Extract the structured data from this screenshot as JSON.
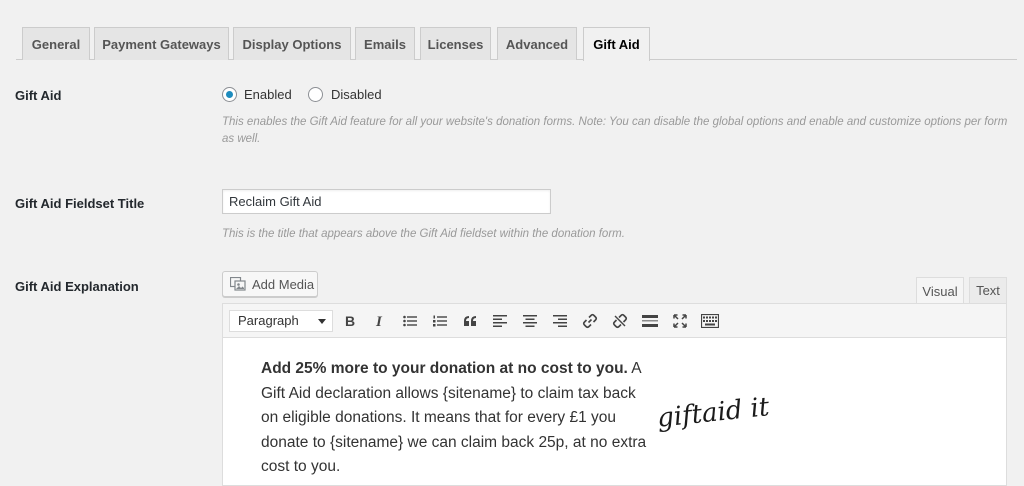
{
  "tabs": [
    {
      "label": "General",
      "active": false
    },
    {
      "label": "Payment Gateways",
      "active": false
    },
    {
      "label": "Display Options",
      "active": false
    },
    {
      "label": "Emails",
      "active": false
    },
    {
      "label": "Licenses",
      "active": false
    },
    {
      "label": "Advanced",
      "active": false
    },
    {
      "label": "Gift Aid",
      "active": true
    }
  ],
  "gift_aid": {
    "label": "Gift Aid",
    "options": [
      {
        "label": "Enabled",
        "checked": true
      },
      {
        "label": "Disabled",
        "checked": false
      }
    ],
    "description": "This enables the Gift Aid feature for all your website's donation forms. Note: You can disable the global options and enable and customize options per form as well."
  },
  "fieldset_title": {
    "label": "Gift Aid Fieldset Title",
    "value": "Reclaim Gift Aid",
    "description": "This is the title that appears above the Gift Aid fieldset within the donation form."
  },
  "explanation": {
    "label": "Gift Aid Explanation",
    "add_media_label": "Add Media",
    "visual_tab": "Visual",
    "text_tab": "Text",
    "format_select": "Paragraph",
    "toolbar": [
      {
        "name": "bold-icon"
      },
      {
        "name": "italic-icon"
      },
      {
        "name": "bullet-list-icon"
      },
      {
        "name": "numbered-list-icon"
      },
      {
        "name": "blockquote-icon"
      },
      {
        "name": "align-left-icon"
      },
      {
        "name": "align-center-icon"
      },
      {
        "name": "align-right-icon"
      },
      {
        "name": "insert-link-icon"
      },
      {
        "name": "remove-link-icon"
      },
      {
        "name": "read-more-icon"
      },
      {
        "name": "fullscreen-icon"
      },
      {
        "name": "toolbar-toggle-icon"
      }
    ],
    "content_bold": "Add 25% more to your donation at no cost to you.",
    "content_rest": " A Gift Aid declaration allows {sitename} to claim tax back on eligible donations. It means that for every £1 you donate to {sitename} we can claim back 25p, at no extra cost to you.",
    "logo_text": "giftaid it"
  },
  "colors": {
    "accent": "#1e8cbe",
    "background": "#f1f1f1"
  }
}
